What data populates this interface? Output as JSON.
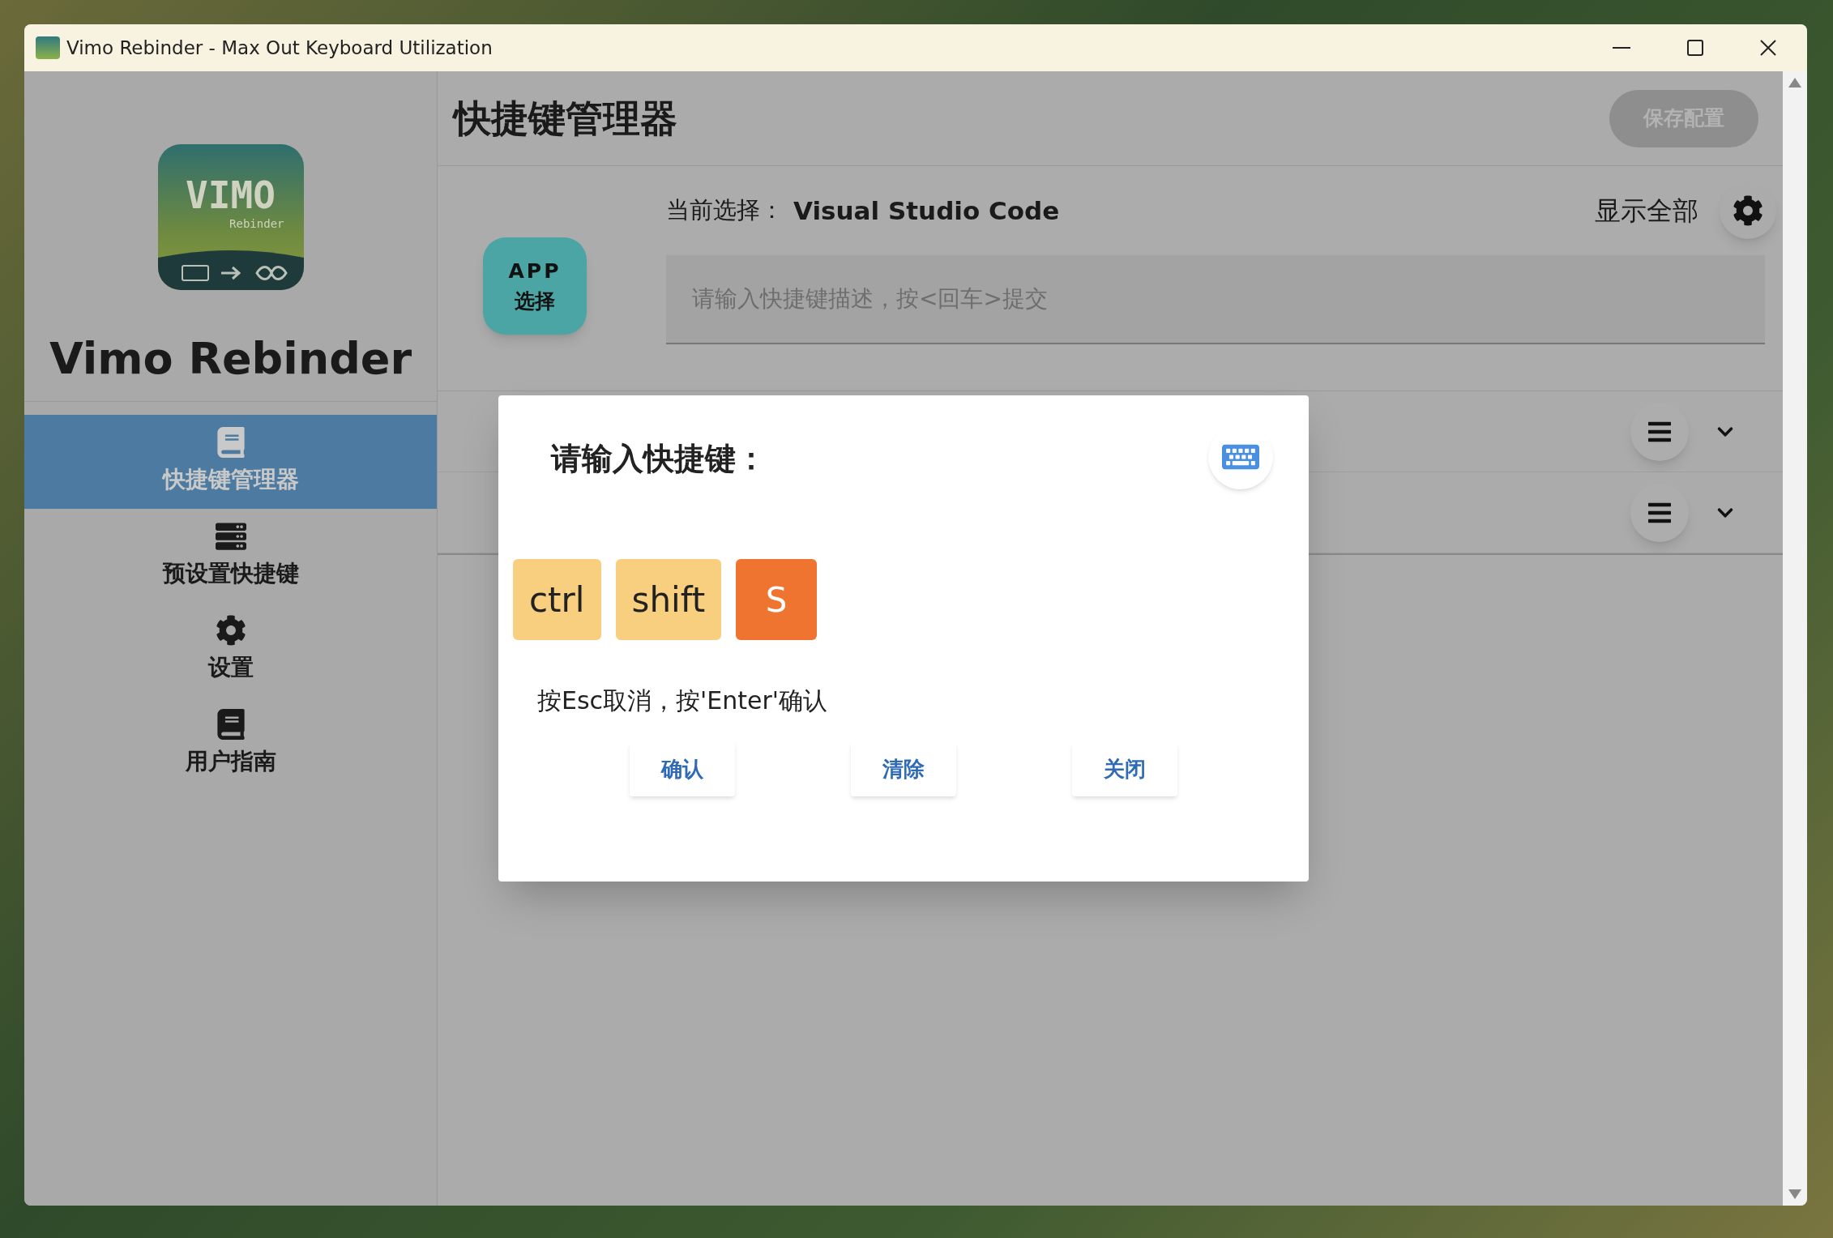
{
  "window": {
    "title": "Vimo Rebinder - Max Out Keyboard Utilization"
  },
  "sidebar": {
    "logo": {
      "title": "VIMO",
      "subtitle": "Rebinder"
    },
    "app_name": "Vimo Rebinder",
    "items": [
      {
        "label": "快捷键管理器",
        "kind": "book",
        "selected": true
      },
      {
        "label": "预设置快捷键",
        "kind": "server",
        "selected": false
      },
      {
        "label": "设置",
        "kind": "gear",
        "selected": false
      },
      {
        "label": "用户指南",
        "kind": "book",
        "selected": false
      }
    ]
  },
  "header": {
    "title": "快捷键管理器",
    "save_button": "保存配置"
  },
  "app_select": {
    "line_1": "APP",
    "line_2": "选择"
  },
  "current": {
    "label": "当前选择：",
    "value": "Visual Studio Code"
  },
  "show_all": "显示全部",
  "input": {
    "placeholder": "请输入快捷键描述，按<回车>提交"
  },
  "shortcut_rows": [
    {
      "expanded": false
    },
    {
      "expanded": false
    }
  ],
  "dialog": {
    "title": "请输入快捷键：",
    "keys": [
      {
        "label": "ctrl",
        "kind": "modifier"
      },
      {
        "label": "shift",
        "kind": "modifier"
      },
      {
        "label": "S",
        "kind": "main"
      }
    ],
    "hint": "按Esc取消，按'Enter'确认",
    "buttons": [
      "确认",
      "清除",
      "关闭"
    ]
  }
}
